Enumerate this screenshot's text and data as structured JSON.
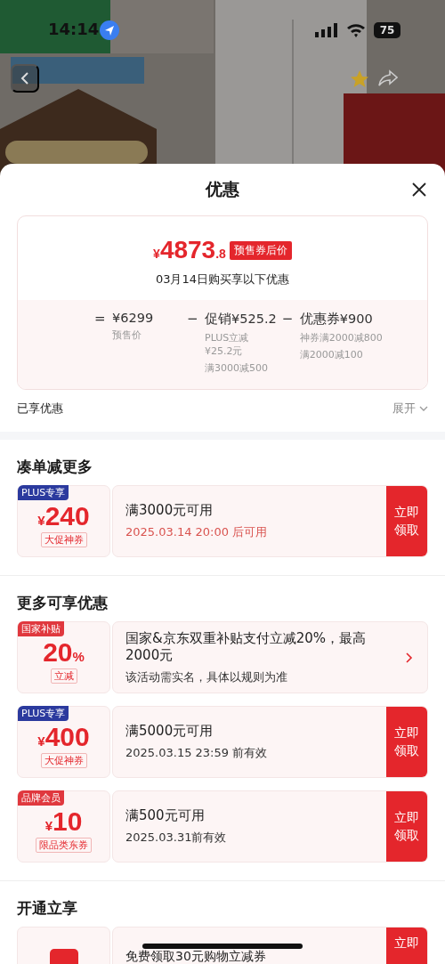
{
  "status_bar": {
    "time": "14:14",
    "battery": "75"
  },
  "sheet": {
    "title": "优惠",
    "summary": {
      "currency": "¥",
      "price_integer": "4873",
      "price_decimal": ".8",
      "badge": "预售券后价",
      "note": "03月14日购买享以下优惠",
      "breakdown": [
        {
          "operator": "=",
          "amount": "¥6299",
          "details": [
            "预售价"
          ]
        },
        {
          "operator": "−",
          "amount": "促销¥525.2",
          "details": [
            "PLUS立减¥25.2元",
            "满3000减500"
          ]
        },
        {
          "operator": "−",
          "amount": "优惠券¥900",
          "details": [
            "神券满2000减800",
            "满2000减100"
          ]
        }
      ]
    },
    "enjoyed": {
      "label": "已享优惠",
      "toggle": "展开"
    },
    "sections": [
      {
        "title": "凑单减更多",
        "coupons": [
          {
            "kind": "voucher",
            "tag": "PLUS专享",
            "color": "#2b3a9e",
            "currency": "¥",
            "amount": "240",
            "label": "大促神券",
            "title": "满3000元可用",
            "subtitle": "2025.03.14 20:00 后可用",
            "highlighted": true,
            "action": "立即领取"
          }
        ]
      },
      {
        "title": "更多可享优惠",
        "coupons": [
          {
            "kind": "subsidy",
            "tag": "国家补贴",
            "color": "#e0383e",
            "amount": "20",
            "unit": "%",
            "label": "立减",
            "title": "国家&京东双重补贴支付立减20%，最高2000元",
            "subtitle": "该活动需实名，具体以规则为准",
            "highlighted": false
          },
          {
            "kind": "voucher",
            "tag": "PLUS专享",
            "color": "#2b3a9e",
            "currency": "¥",
            "amount": "400",
            "label": "大促神券",
            "title": "满5000元可用",
            "subtitle": "2025.03.15 23:59 前有效",
            "highlighted": false,
            "action": "立即领取"
          },
          {
            "kind": "voucher",
            "tag": "品牌会员",
            "color": "#e0383e",
            "currency": "¥",
            "amount": "10",
            "label": "限品类东券",
            "title": "满500元可用",
            "subtitle": "2025.03.31前有效",
            "highlighted": false,
            "action": "立即领取"
          }
        ]
      },
      {
        "title": "开通立享",
        "coupons": [
          {
            "kind": "open",
            "title": "免费领取30元购物立减券",
            "action": "立即"
          }
        ]
      }
    ]
  }
}
